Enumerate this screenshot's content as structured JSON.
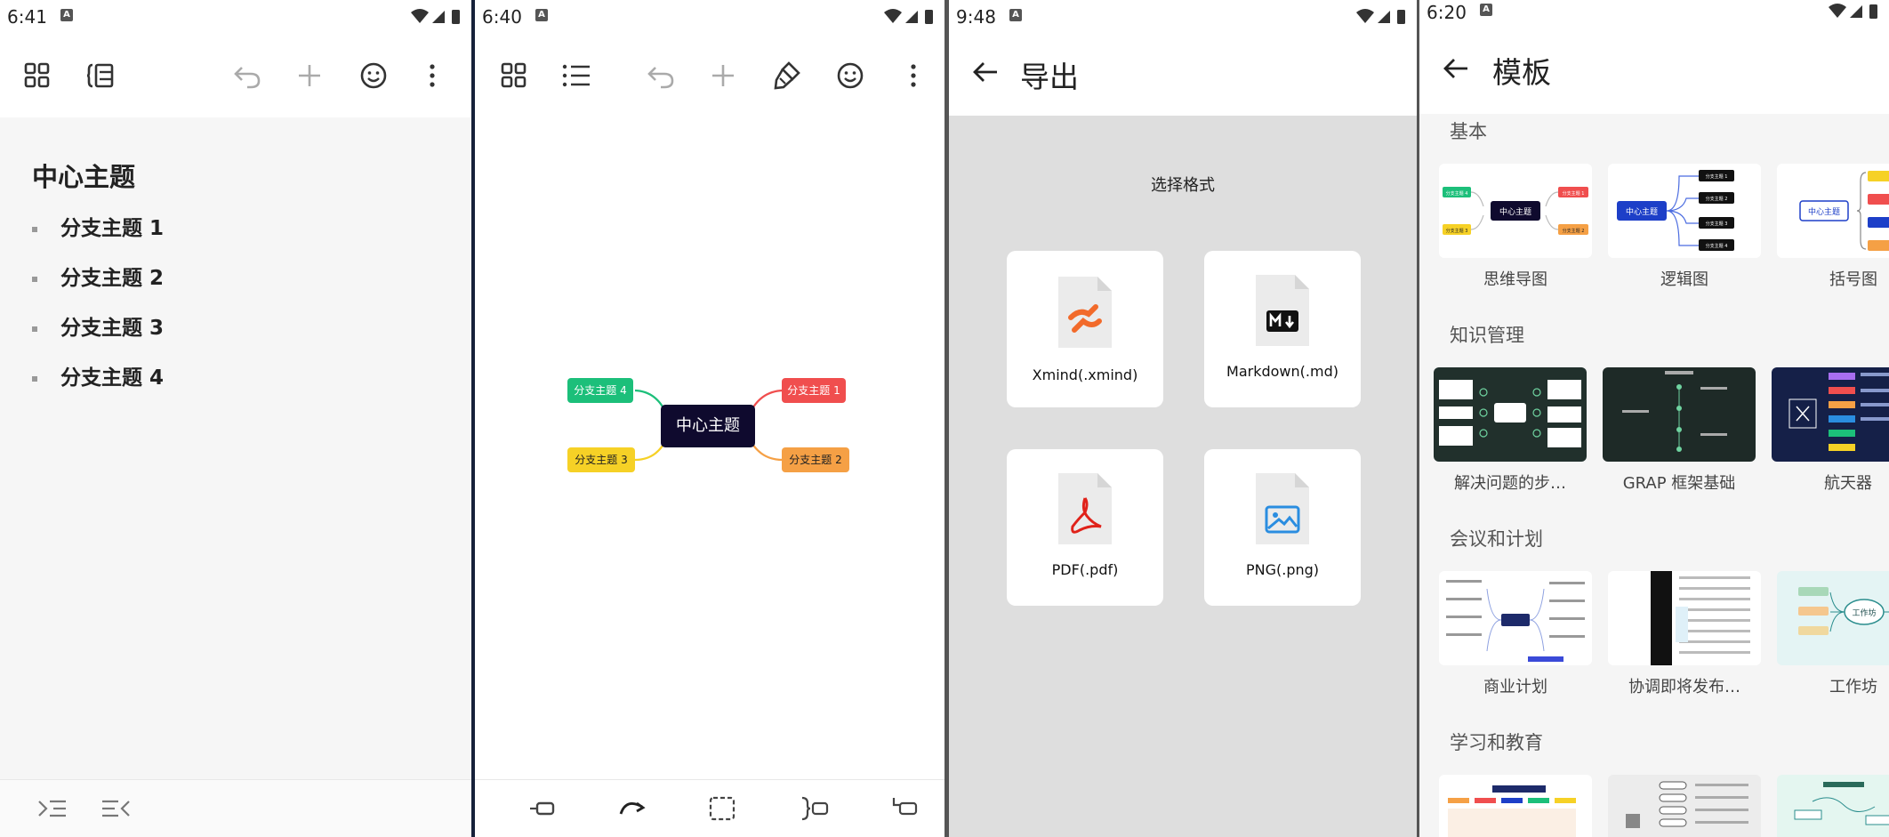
{
  "panel1": {
    "status_time": "6:41",
    "outline_title": "中心主题",
    "outline_items": [
      "分支主题 1",
      "分支主题 2",
      "分支主题 3",
      "分支主题 4"
    ]
  },
  "panel2": {
    "status_time": "6:40",
    "center_topic": "中心主题",
    "branches": [
      "分支主题 1",
      "分支主题 2",
      "分支主题 3",
      "分支主题 4"
    ],
    "colors": {
      "branch1": "#f04e4e",
      "branch2": "#f5a045",
      "branch3": "#f6d126",
      "branch4": "#1cbf7a"
    }
  },
  "panel3": {
    "status_time": "9:48",
    "title": "导出",
    "select_format": "选择格式",
    "formats": [
      "Xmind(.xmind)",
      "Markdown(.md)",
      "PDF(.pdf)",
      "PNG(.png)"
    ]
  },
  "panel4": {
    "status_time": "6:20",
    "title": "模板",
    "sections": [
      {
        "name": "基本",
        "items": [
          "思维导图",
          "逻辑图",
          "括号图"
        ]
      },
      {
        "name": "知识管理",
        "items": [
          "解决问题的步…",
          "GRAP 框架基础",
          "航天器"
        ]
      },
      {
        "name": "会议和计划",
        "items": [
          "商业计划",
          "协调即将发布…",
          "工作坊"
        ]
      },
      {
        "name": "学习和教育",
        "items": []
      }
    ],
    "thumb_center": "中心主题",
    "thumb_branches": [
      "分支主题 1",
      "分支主题 2",
      "分支主题 3",
      "分支主题 4"
    ],
    "thumb_workshop": "工作坊"
  }
}
